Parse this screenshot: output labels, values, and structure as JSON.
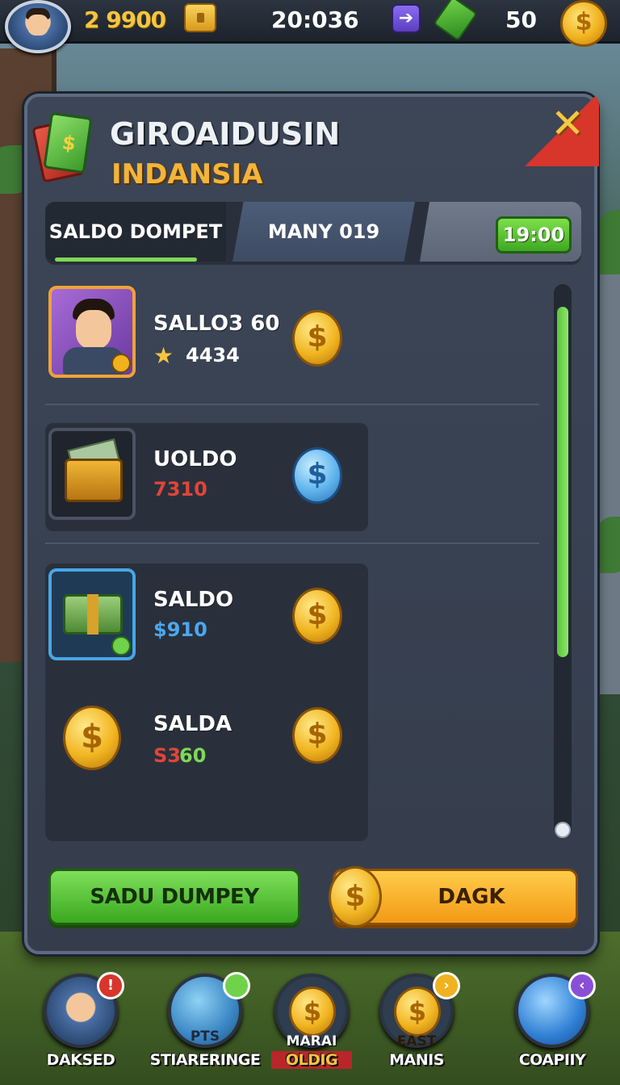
{
  "topbar": {
    "coins": "2 9900",
    "clock": "20:036",
    "cash": "50",
    "arrow_glyph": "➔",
    "coin_glyph": "$"
  },
  "panel": {
    "title": "GIROAIDUSIN",
    "subtitle": "INDANSIA",
    "close_glyph": "✕"
  },
  "tabs": [
    {
      "label": "SALDO DOMPET",
      "active": true
    },
    {
      "label": "MANY 019",
      "active": false
    },
    {
      "label": "",
      "active": false
    }
  ],
  "timer": "19:00",
  "rows": [
    {
      "label": "SALLO3 60",
      "value": "4434",
      "value_color": "#ffffff",
      "star": "★",
      "coin": "gold"
    },
    {
      "label": "UOLDO",
      "value": "7310",
      "value_color": "#e0453a",
      "coin": "blue"
    },
    {
      "label": "SALDO",
      "value": "$910",
      "value_color": "#4aa8f0",
      "coin": "gold"
    },
    {
      "label": "SALDA",
      "value_a": "S3",
      "value_a_color": "#e0453a",
      "value_b": "60",
      "value_b_color": "#7ed957",
      "coin": "gold"
    }
  ],
  "coin_glyph": "$",
  "scroll": {
    "position_fraction": 0.0,
    "visible_fraction": 0.63
  },
  "buttons": {
    "primary": "SADU DUMPEY",
    "secondary": "DAGK"
  },
  "bottom_nav": [
    {
      "label": "DAKSED",
      "badge": "!",
      "badge_color": "#d8352b"
    },
    {
      "label": "STIARERINGE",
      "sublabel": "PTS",
      "badge": "",
      "badge_color": "#6fd24a"
    },
    {
      "label": "OLDIG",
      "sublabel": "MARAI",
      "badge": "",
      "badge_color": ""
    },
    {
      "label": "MANIS",
      "sublabel": "EAST",
      "badge": "›",
      "badge_color": "#f0b21f"
    },
    {
      "label": "COAPIIY",
      "badge": "‹",
      "badge_color": "#8a4fd6"
    }
  ],
  "colors": {
    "accent_green": "#7ed957",
    "accent_orange": "#f29a16",
    "close_red": "#d8352b",
    "gold": "#f1b521"
  }
}
